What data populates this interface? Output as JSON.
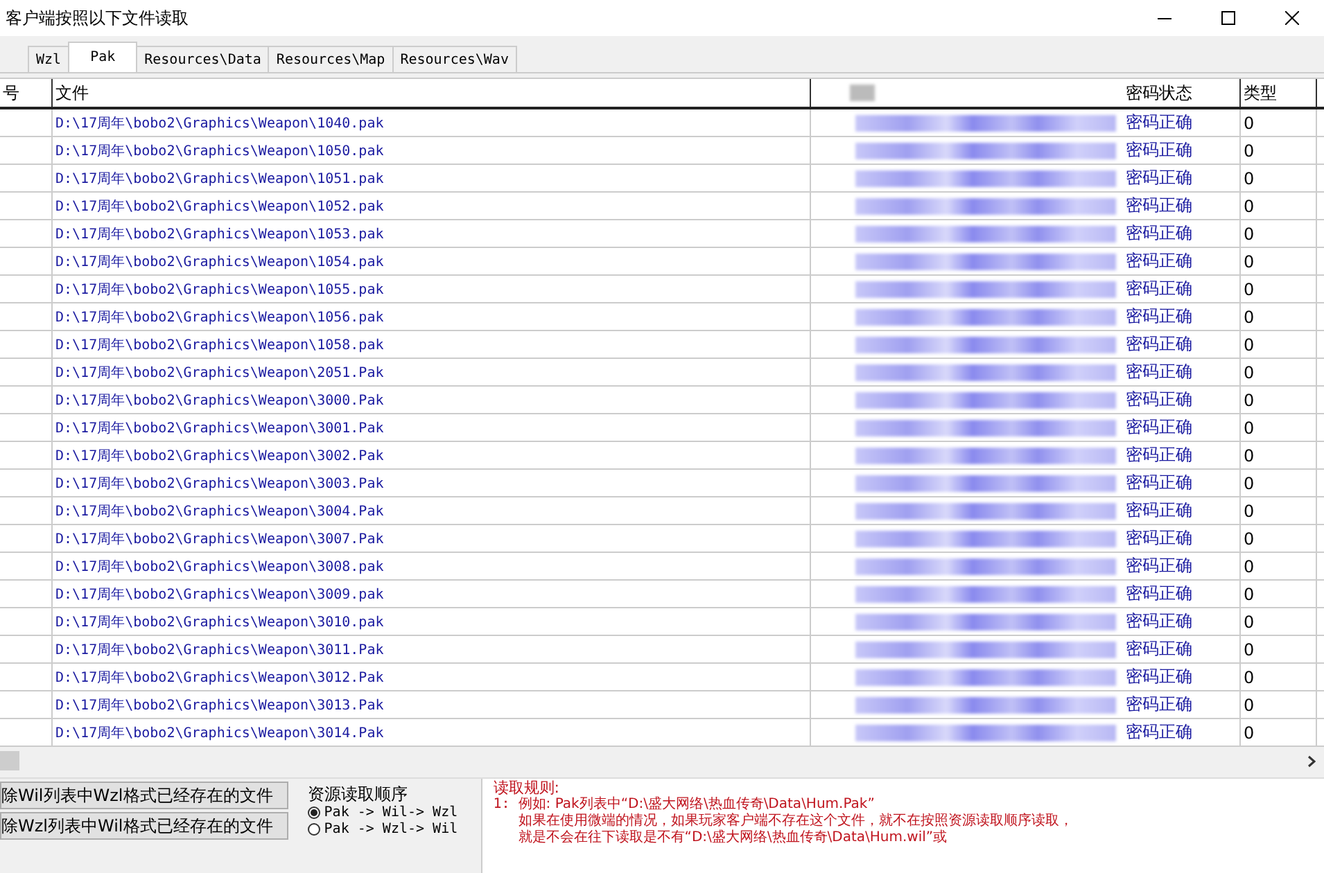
{
  "window": {
    "title": "客户端按照以下文件读取"
  },
  "tabs": [
    {
      "label": "Wzl",
      "selected": false
    },
    {
      "label": "Pak",
      "selected": true
    },
    {
      "label": "Resources\\Data",
      "selected": false
    },
    {
      "label": "Resources\\Map",
      "selected": false
    },
    {
      "label": "Resources\\Wav",
      "selected": false
    }
  ],
  "table": {
    "columns": [
      "号",
      "文件",
      "密码状态",
      "类型"
    ],
    "rows": [
      {
        "file": "D:\\17周年\\bobo2\\Graphics\\Weapon\\1040.pak",
        "status": "密码正确",
        "type": "0"
      },
      {
        "file": "D:\\17周年\\bobo2\\Graphics\\Weapon\\1050.pak",
        "status": "密码正确",
        "type": "0"
      },
      {
        "file": "D:\\17周年\\bobo2\\Graphics\\Weapon\\1051.pak",
        "status": "密码正确",
        "type": "0"
      },
      {
        "file": "D:\\17周年\\bobo2\\Graphics\\Weapon\\1052.pak",
        "status": "密码正确",
        "type": "0"
      },
      {
        "file": "D:\\17周年\\bobo2\\Graphics\\Weapon\\1053.pak",
        "status": "密码正确",
        "type": "0"
      },
      {
        "file": "D:\\17周年\\bobo2\\Graphics\\Weapon\\1054.pak",
        "status": "密码正确",
        "type": "0"
      },
      {
        "file": "D:\\17周年\\bobo2\\Graphics\\Weapon\\1055.pak",
        "status": "密码正确",
        "type": "0"
      },
      {
        "file": "D:\\17周年\\bobo2\\Graphics\\Weapon\\1056.pak",
        "status": "密码正确",
        "type": "0"
      },
      {
        "file": "D:\\17周年\\bobo2\\Graphics\\Weapon\\1058.pak",
        "status": "密码正确",
        "type": "0"
      },
      {
        "file": "D:\\17周年\\bobo2\\Graphics\\Weapon\\2051.Pak",
        "status": "密码正确",
        "type": "0"
      },
      {
        "file": "D:\\17周年\\bobo2\\Graphics\\Weapon\\3000.Pak",
        "status": "密码正确",
        "type": "0"
      },
      {
        "file": "D:\\17周年\\bobo2\\Graphics\\Weapon\\3001.Pak",
        "status": "密码正确",
        "type": "0"
      },
      {
        "file": "D:\\17周年\\bobo2\\Graphics\\Weapon\\3002.Pak",
        "status": "密码正确",
        "type": "0"
      },
      {
        "file": "D:\\17周年\\bobo2\\Graphics\\Weapon\\3003.Pak",
        "status": "密码正确",
        "type": "0"
      },
      {
        "file": "D:\\17周年\\bobo2\\Graphics\\Weapon\\3004.Pak",
        "status": "密码正确",
        "type": "0"
      },
      {
        "file": "D:\\17周年\\bobo2\\Graphics\\Weapon\\3007.Pak",
        "status": "密码正确",
        "type": "0"
      },
      {
        "file": "D:\\17周年\\bobo2\\Graphics\\Weapon\\3008.pak",
        "status": "密码正确",
        "type": "0"
      },
      {
        "file": "D:\\17周年\\bobo2\\Graphics\\Weapon\\3009.pak",
        "status": "密码正确",
        "type": "0"
      },
      {
        "file": "D:\\17周年\\bobo2\\Graphics\\Weapon\\3010.pak",
        "status": "密码正确",
        "type": "0"
      },
      {
        "file": "D:\\17周年\\bobo2\\Graphics\\Weapon\\3011.Pak",
        "status": "密码正确",
        "type": "0"
      },
      {
        "file": "D:\\17周年\\bobo2\\Graphics\\Weapon\\3012.Pak",
        "status": "密码正确",
        "type": "0"
      },
      {
        "file": "D:\\17周年\\bobo2\\Graphics\\Weapon\\3013.Pak",
        "status": "密码正确",
        "type": "0"
      },
      {
        "file": "D:\\17周年\\bobo2\\Graphics\\Weapon\\3014.Pak",
        "status": "密码正确",
        "type": "0"
      }
    ]
  },
  "buttons": [
    "除Wil列表中Wzl格式已经存在的文件",
    "除Wzl列表中Wil格式已经存在的文件"
  ],
  "read_order": {
    "title": "资源读取顺序",
    "options": [
      {
        "label": "Pak -> Wil-> Wzl",
        "selected": true
      },
      {
        "label": "Pak -> Wzl-> Wil",
        "selected": false
      }
    ]
  },
  "rules": {
    "title": "读取规则:",
    "lines": [
      {
        "number": "1:",
        "text": "例如: Pak列表中“D:\\盛大网络\\热血传奇\\Data\\Hum.Pak”"
      },
      {
        "text": "如果在使用微端的情况，如果玩家客户端不存在这个文件，就不在按照资源读取顺序读取，"
      },
      {
        "text": "就是不会在往下读取是不有“D:\\盛大网络\\热血传奇\\Data\\Hum.wil”或"
      }
    ]
  }
}
